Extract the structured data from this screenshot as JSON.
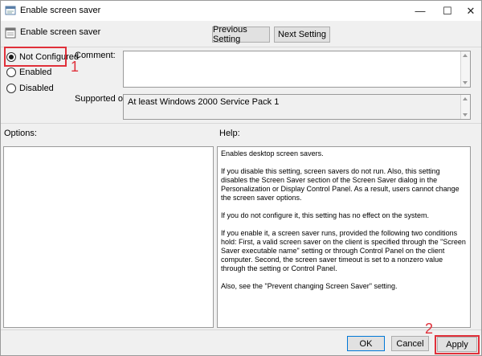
{
  "window": {
    "title": "Enable screen saver",
    "minimize_glyph": "—",
    "maximize_glyph": "☐",
    "close_glyph": "✕"
  },
  "header": {
    "title": "Enable screen saver",
    "prev_label": "Previous Setting",
    "next_label": "Next Setting"
  },
  "state": {
    "options": [
      {
        "label": "Not Configured",
        "selected": true
      },
      {
        "label": "Enabled",
        "selected": false
      },
      {
        "label": "Disabled",
        "selected": false
      }
    ]
  },
  "comment": {
    "label": "Comment:",
    "value": ""
  },
  "supported": {
    "label": "Supported on:",
    "value": "At least Windows 2000 Service Pack 1"
  },
  "panels": {
    "options_label": "Options:",
    "help_label": "Help:"
  },
  "help": {
    "paragraphs": [
      "Enables desktop screen savers.",
      "If you disable this setting, screen savers do not run. Also, this setting disables the Screen Saver section of the Screen Saver dialog in the Personalization or Display Control Panel. As a result, users cannot change the screen saver options.",
      "If you do not configure it, this setting has no effect on the system.",
      "If you enable it, a screen saver runs, provided the following two conditions hold: First, a valid screen saver on the client is specified through the \"Screen Saver executable name\" setting or through Control Panel on the client computer. Second, the screen saver timeout is set to a nonzero value through the setting or Control Panel.",
      "Also, see the \"Prevent changing Screen Saver\" setting."
    ]
  },
  "buttons": {
    "ok": "OK",
    "cancel": "Cancel",
    "apply": "Apply"
  },
  "annotations": {
    "step1": "1",
    "step2": "2"
  },
  "colors": {
    "annotation_red": "#e0303a",
    "focus_blue": "#0078d7"
  }
}
